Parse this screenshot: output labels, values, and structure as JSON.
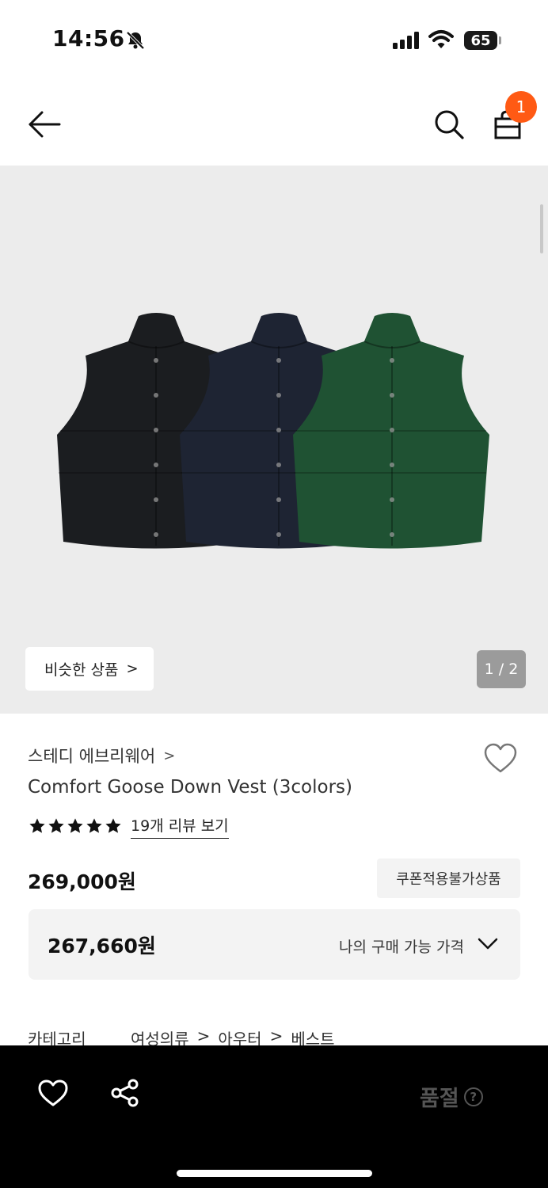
{
  "status_bar": {
    "time": "14:56",
    "battery": "65"
  },
  "header": {
    "cart_count": "1"
  },
  "gallery": {
    "similar_label": "비슷한 상품",
    "page_indicator": "1 / 2",
    "vest_colors": [
      "#1b1d20",
      "#1e2433",
      "#1f5233"
    ]
  },
  "product": {
    "brand": "스테디 에브리웨어",
    "title": "Comfort Goose Down Vest (3colors)",
    "rating_stars": 5,
    "review_link": "19개 리뷰 보기",
    "price": "269,000원",
    "coupon_note": "쿠폰적용불가상품",
    "my_price": "267,660원",
    "my_price_label": "나의 구매 가능 가격",
    "category_key": "카테고리",
    "category_path": [
      "여성의류",
      ">",
      "아우터",
      ">",
      "베스트"
    ]
  },
  "bottom_bar": {
    "status": "품절",
    "help": "?"
  },
  "colors": {
    "accent": "#ff5a14",
    "bar": "#000000"
  }
}
